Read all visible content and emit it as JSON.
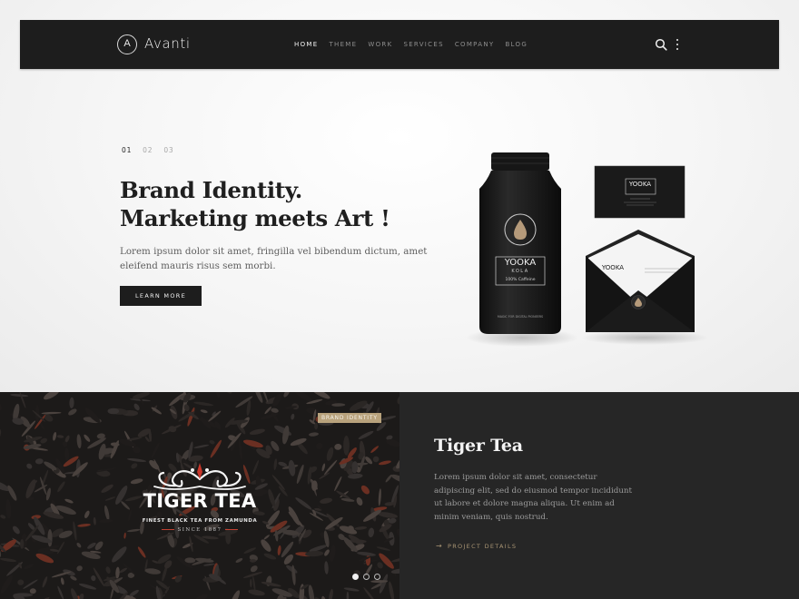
{
  "brand": {
    "logo_letter": "A",
    "name": "Avanti"
  },
  "nav": {
    "items": [
      {
        "label": "HOME",
        "active": true
      },
      {
        "label": "THEME",
        "active": false
      },
      {
        "label": "WORK",
        "active": false
      },
      {
        "label": "SERVICES",
        "active": false
      },
      {
        "label": "COMPANY",
        "active": false
      },
      {
        "label": "BLOG",
        "active": false
      }
    ],
    "search_icon": "search-icon",
    "more_icon": "vertical-dots-icon"
  },
  "hero": {
    "slides": [
      "01",
      "02",
      "03"
    ],
    "active_slide": "01",
    "title_line1": "Brand Identity.",
    "title_line2": "Marketing meets Art !",
    "desc_line1": "Lorem ipsum dolor sit amet, fringilla vel bibendum dictum, amet",
    "desc_line2": "eleifend mauris risus sem morbi.",
    "button_label": "LEARN MORE",
    "mockup": {
      "bottle_brand": "YOOKA",
      "bottle_sub": "KOLA",
      "bottle_caption": "100% Caffeine",
      "bottle_footer": "MAGIC FOR DIGITAL PIONEERS",
      "card_brand": "YOOKA",
      "envelope_brand": "YOOKA"
    }
  },
  "project": {
    "tag": "BRAND IDENTITY",
    "image_title": "TIGER TEA",
    "image_subtitle": "FINEST BLACK TEA FROM ZAMUNDA",
    "image_since": "SINCE 1887",
    "carousel_count": 3,
    "carousel_active": 1,
    "title": "Tiger Tea",
    "desc_line1": "Lorem ipsum dolor sit amet, consectetur",
    "desc_line2": "adipiscing elit, sed do eiusmod tempor incididunt",
    "desc_line3": "ut labore et dolore magna aliqua. Ut enim ad",
    "desc_line4": "minim veniam, quis nostrud.",
    "link_label": "PROJECT DETAILS",
    "link_icon": "arrow-right-icon"
  },
  "colors": {
    "dark": "#1d1d1d",
    "panel": "#262626",
    "accent_gold": "#b8a27c",
    "accent_red": "#c14132"
  }
}
